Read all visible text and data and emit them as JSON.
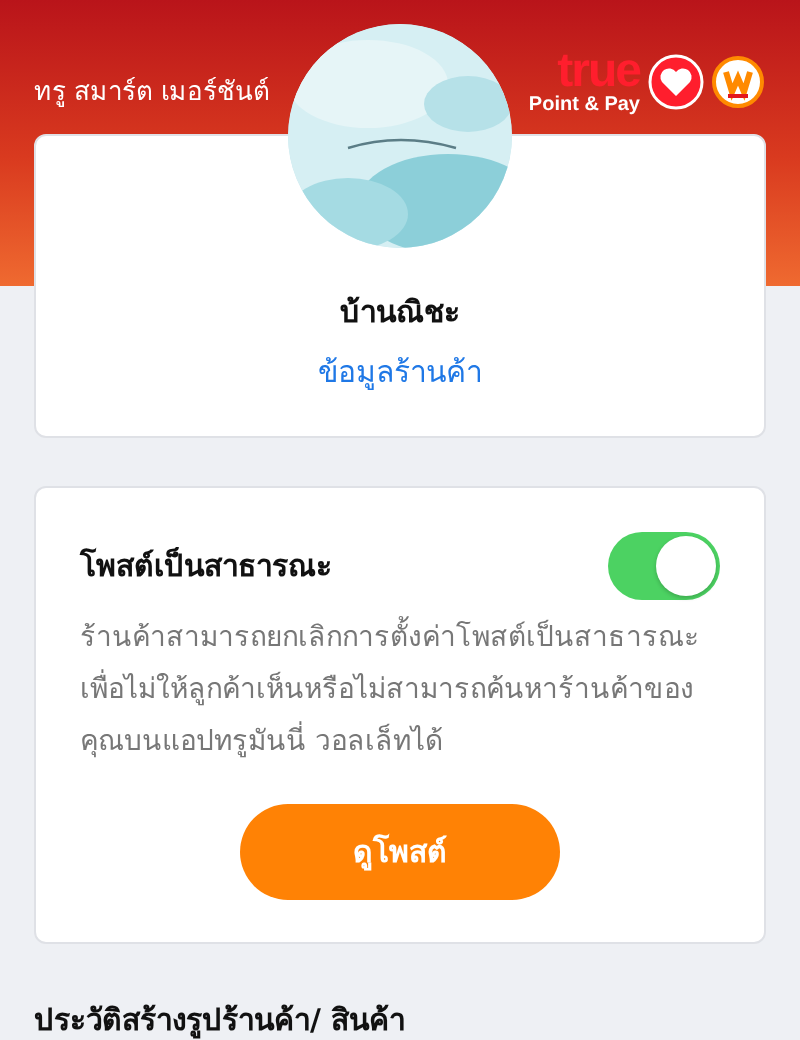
{
  "header": {
    "title": "ทรู สมาร์ต เมอร์ชันต์",
    "logo": {
      "wordmark": "true",
      "tagline": "Point & Pay"
    }
  },
  "shop_card": {
    "shop_name": "บ้านณิชะ",
    "link": "ข้อมูลร้านค้า"
  },
  "public_post_card": {
    "title": "โพสต์เป็นสาธารณะ",
    "toggle": {
      "on": true
    },
    "description": "ร้านค้าสามารถยกเลิกการตั้งค่าโพสต์เป็นสาธารณะ เพื่อไม่ให้ลูกค้าเห็นหรือไม่สามารถค้นหาร้านค้าของคุณบนแอปทรูมันนี่ วอลเล็ทได้",
    "button": "ดูโพสต์"
  },
  "section_title": "ประวัติสร้างรูปร้านค้า/ สินค้า"
}
